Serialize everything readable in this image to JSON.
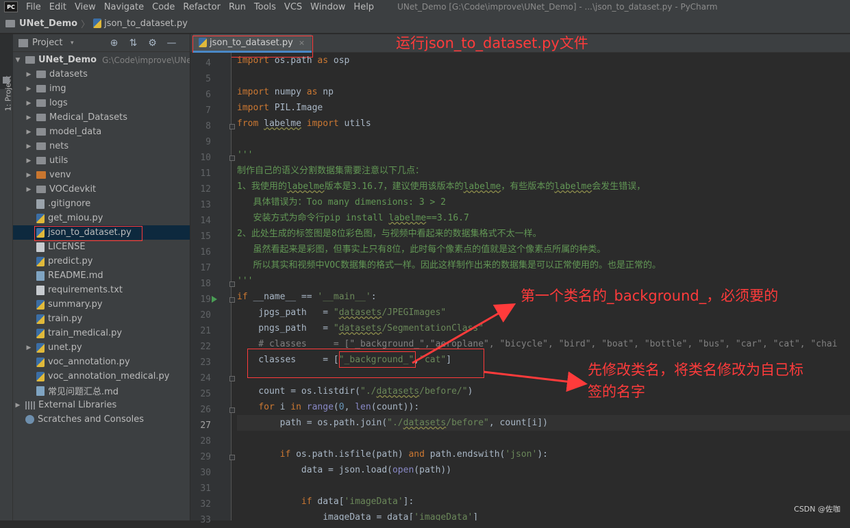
{
  "menubar": {
    "logo": "PC",
    "items": [
      "File",
      "Edit",
      "View",
      "Navigate",
      "Code",
      "Refactor",
      "Run",
      "Tools",
      "VCS",
      "Window",
      "Help"
    ],
    "window_title": "UNet_Demo [G:\\Code\\improve\\UNet_Demo] - ...\\json_to_dataset.py - PyCharm"
  },
  "navbar": {
    "project": "UNet_Demo",
    "separator": "〉",
    "file": "json_to_dataset.py"
  },
  "side_strip": {
    "tab_label": "1: Project"
  },
  "project_panel": {
    "title": "Project",
    "dropdown_icon": "chevron-down-icon",
    "tools": [
      "⊕",
      "⇅",
      "⚙",
      "—"
    ],
    "root": {
      "name": "UNet_Demo",
      "path": "G:\\Code\\improve\\UNet_"
    },
    "items": [
      {
        "label": "datasets",
        "type": "folder",
        "expandable": true
      },
      {
        "label": "img",
        "type": "folder",
        "expandable": true
      },
      {
        "label": "logs",
        "type": "folder",
        "expandable": true
      },
      {
        "label": "Medical_Datasets",
        "type": "folder",
        "expandable": true
      },
      {
        "label": "model_data",
        "type": "folder",
        "expandable": true
      },
      {
        "label": "nets",
        "type": "folder",
        "expandable": true
      },
      {
        "label": "utils",
        "type": "folder",
        "expandable": true
      },
      {
        "label": "venv",
        "type": "folder-orange",
        "expandable": true
      },
      {
        "label": "VOCdevkit",
        "type": "folder",
        "expandable": true
      },
      {
        "label": ".gitignore",
        "type": "generic"
      },
      {
        "label": "get_miou.py",
        "type": "py"
      },
      {
        "label": "json_to_dataset.py",
        "type": "py",
        "selected": true
      },
      {
        "label": "LICENSE",
        "type": "txt"
      },
      {
        "label": "predict.py",
        "type": "py"
      },
      {
        "label": "README.md",
        "type": "md"
      },
      {
        "label": "requirements.txt",
        "type": "txt"
      },
      {
        "label": "summary.py",
        "type": "py"
      },
      {
        "label": "train.py",
        "type": "py"
      },
      {
        "label": "train_medical.py",
        "type": "py"
      },
      {
        "label": "unet.py",
        "type": "py",
        "expandable": true
      },
      {
        "label": "voc_annotation.py",
        "type": "py"
      },
      {
        "label": "voc_annotation_medical.py",
        "type": "py"
      },
      {
        "label": "常见问题汇总.md",
        "type": "md"
      }
    ],
    "external_libraries": "External Libraries",
    "scratches": "Scratches and Consoles"
  },
  "editor": {
    "tab_label": "json_to_dataset.py",
    "tab_close": "×",
    "line_numbers": [
      "4",
      "5",
      "6",
      "7",
      "8",
      "9",
      "10",
      "11",
      "12",
      "13",
      "14",
      "15",
      "16",
      "17",
      "18",
      "19",
      "20",
      "21",
      "22",
      "23",
      "24",
      "25",
      "26",
      "27",
      "28",
      "29",
      "30",
      "31",
      "32",
      "33"
    ],
    "current_line": "27"
  },
  "annotations": {
    "run_file": "运行json_to_dataset.py文件",
    "background_note": "第一个类名的_background_，必须要的",
    "rename_note_line1": "先修改类名，将类名修改为自己标",
    "rename_note_line2": "签的名字",
    "arrow_color": "#ff3b3b"
  },
  "watermark": "CSDN @佐咖"
}
